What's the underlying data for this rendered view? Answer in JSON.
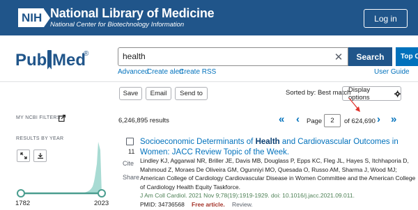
{
  "banner": {
    "logo_text": "NIH",
    "title": "National Library of Medicine",
    "subtitle": "National Center for Biotechnology Information",
    "login_label": "Log in",
    "background_color": "#20558a"
  },
  "logo": {
    "text_left": "Pub",
    "text_right": "Med",
    "trademark": "®"
  },
  "search": {
    "query": "health",
    "clear_icon": "close-icon",
    "button_label": "Search",
    "extra_button_label": "Top C",
    "links": [
      "Advanced",
      "Create alert",
      "Create RSS"
    ],
    "help_link": "User Guide"
  },
  "toolbar": {
    "save_label": "Save",
    "email_label": "Email",
    "send_to_label": "Send to",
    "sorted_by": "Sorted by: Best match",
    "display_options_label": "Display options",
    "display_options_icon": "gear-icon"
  },
  "sidebar": {
    "filters_label": "MY NCBI FILTERS",
    "filters_icon": "external-link-icon",
    "results_by_year_label": "RESULTS BY YEAR",
    "expand_icon": "expand-icon",
    "download_icon": "download-icon",
    "year_start": "1782",
    "year_end": "2023"
  },
  "results": {
    "count_text": "6,246,895 results",
    "page_label": "Page",
    "page_value": "2",
    "of_total": "of 624,690",
    "pager_icons": [
      "first-page-icon",
      "prev-page-icon",
      "next-page-icon",
      "last-page-icon"
    ],
    "arrow_color": "#e0322b"
  },
  "article": {
    "number": "11",
    "cite_label": "Cite",
    "share_label": "Share",
    "title_before": "Socioeconomic Determinants of ",
    "title_highlight": "Health",
    "title_after": " and Cardiovascular Outcomes in Women: JACC Review Topic of the Week.",
    "authors": "Lindley KJ, Aggarwal NR, Briller JE, Davis MB, Douglass P, Epps KC, Fleg JL, Hayes S, Itchhaporia D, Mahmoud Z, Moraes De Oliveira GM, Ogunniyi MO, Quesada O, Russo AM, Sharma J, Wood MJ; American College of Cardiology Cardiovascular Disease in Women Committee and the American College of Cardiology Health Equity Taskforce.",
    "citation": "J Am Coll Cardiol. 2021 Nov 9;78(19):1919-1929. doi: 10.1016/j.jacc.2021.09.011.",
    "pmid": "PMID: 34736568",
    "free_label": "Free article.",
    "type_label": "Review."
  }
}
